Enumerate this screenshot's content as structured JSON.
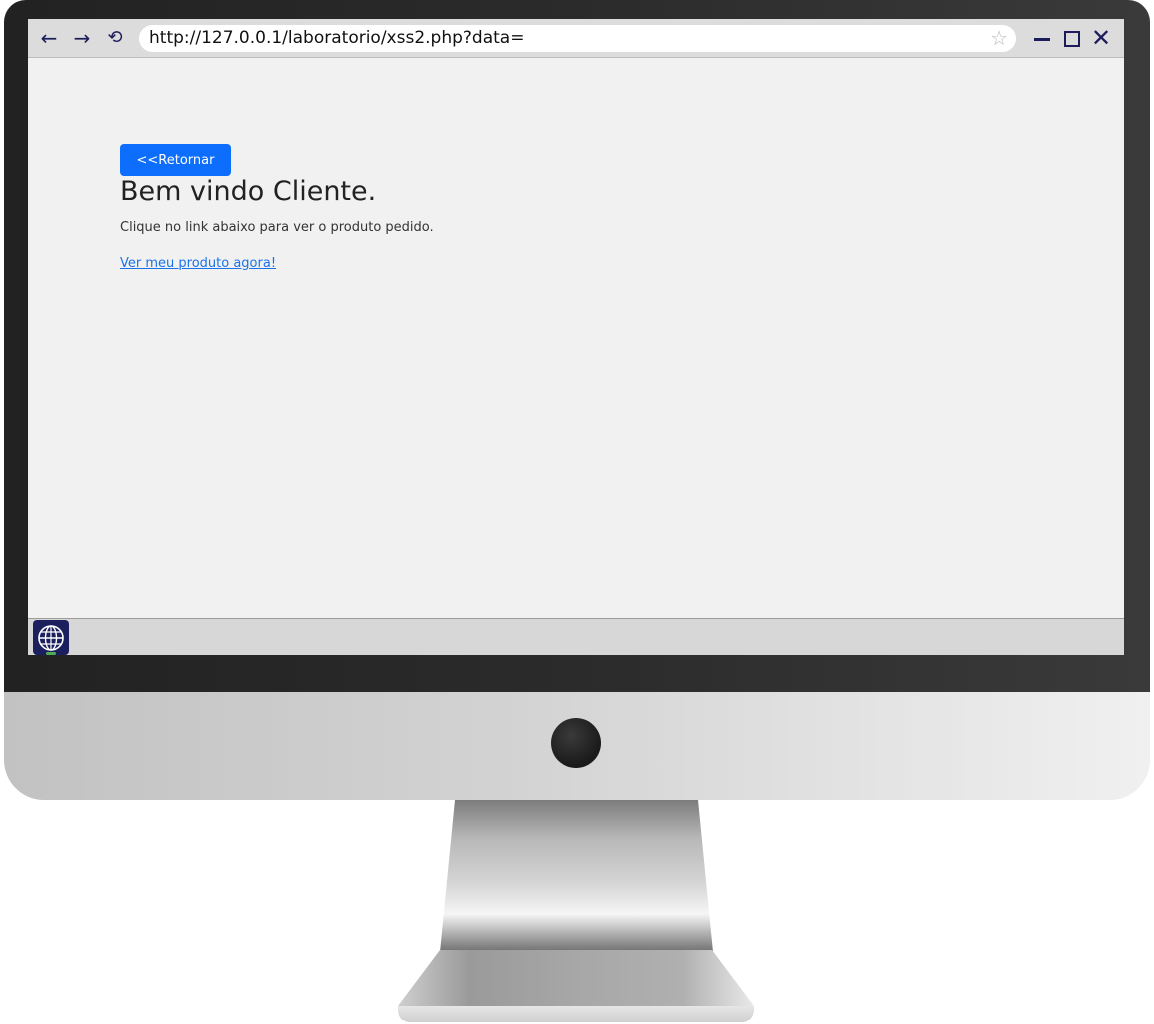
{
  "browser": {
    "url": "http://127.0.0.1/laboratorio/xss2.php?data=",
    "icons": {
      "back": "arrow-left-icon",
      "forward": "arrow-right-icon",
      "reload": "reload-icon",
      "bookmark": "star-icon",
      "minimize": "minimize-icon",
      "maximize": "maximize-icon",
      "close": "close-icon"
    }
  },
  "page": {
    "back_button_label": "<<Retornar",
    "heading": "Bem vindo Cliente.",
    "subtext": "Clique no link abaixo para ver o produto pedido.",
    "link_label": "Ver meu produto agora!"
  },
  "taskbar": {
    "start_icon": "globe-icon"
  },
  "colors": {
    "button_primary": "#0d6efd",
    "link": "#1a73e8",
    "page_background": "#f1f1f1",
    "taskbar_icon_bg": "#1b1f5e"
  }
}
